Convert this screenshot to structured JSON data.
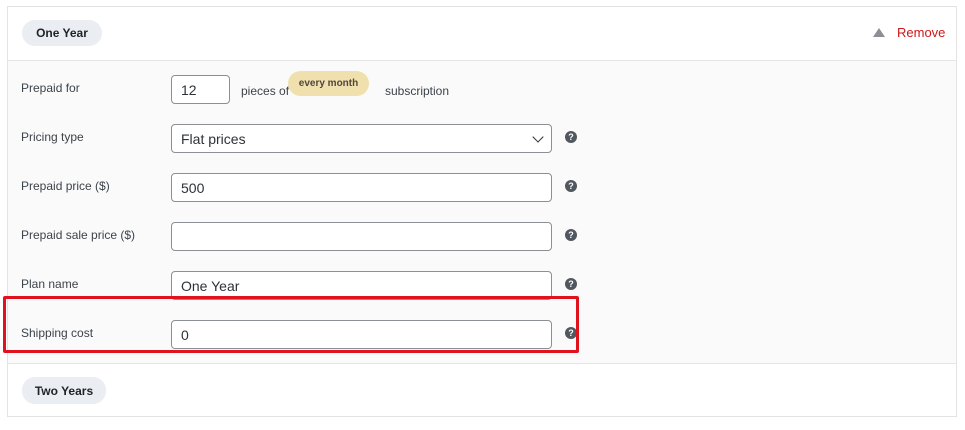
{
  "plans": [
    {
      "name": "One Year"
    },
    {
      "name": "Two Years"
    }
  ],
  "header": {
    "collapse_icon": "triangle-up-icon",
    "remove_label": "Remove"
  },
  "fields": {
    "prepaid_for": {
      "label": "Prepaid for",
      "value": "12",
      "pieces_of": "pieces of",
      "period": "every month",
      "suffix": "subscription"
    },
    "pricing_type": {
      "label": "Pricing type",
      "value": "Flat prices"
    },
    "prepaid_price": {
      "label": "Prepaid price ($)",
      "value": "500"
    },
    "prepaid_sale_price": {
      "label": "Prepaid sale price ($)",
      "value": ""
    },
    "plan_name": {
      "label": "Plan name",
      "value": "One Year"
    },
    "shipping_cost": {
      "label": "Shipping cost",
      "value": "0"
    }
  },
  "help_icon_glyph": "?",
  "colors": {
    "remove": "#cc1818",
    "highlight": "#e0121d",
    "period_badge": "#f0e0ad"
  }
}
